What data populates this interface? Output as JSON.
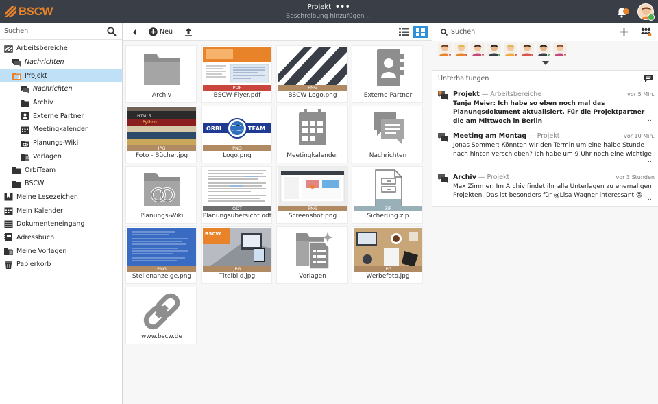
{
  "topbar": {
    "logo_text": "BSCW",
    "title": "Projekt",
    "title_menu": "•••",
    "subtitle": "Beschreibung hinzufügen ...",
    "notification_count": "1",
    "accent": "#e8832a"
  },
  "left": {
    "search_label": "Suchen",
    "tree": [
      {
        "label": "Arbeitsbereiche",
        "icon": "workspaces-icon",
        "indent": 0,
        "italic": false,
        "selected": false
      },
      {
        "label": "Nachrichten",
        "icon": "messages-icon",
        "indent": 1,
        "italic": true,
        "selected": false
      },
      {
        "label": "Projekt",
        "icon": "project-folder-icon",
        "indent": 1,
        "italic": false,
        "selected": true
      },
      {
        "label": "Nachrichten",
        "icon": "messages-icon",
        "indent": 2,
        "italic": true,
        "selected": false
      },
      {
        "label": "Archiv",
        "icon": "folder-icon",
        "indent": 2,
        "italic": false,
        "selected": false
      },
      {
        "label": "Externe Partner",
        "icon": "contacts-icon",
        "indent": 2,
        "italic": false,
        "selected": false
      },
      {
        "label": "Meetingkalender",
        "icon": "calendar-icon",
        "indent": 2,
        "italic": false,
        "selected": false
      },
      {
        "label": "Planungs-Wiki",
        "icon": "wiki-icon",
        "indent": 2,
        "italic": false,
        "selected": false
      },
      {
        "label": "Vorlagen",
        "icon": "templates-icon",
        "indent": 2,
        "italic": false,
        "selected": false
      },
      {
        "label": "OrbiTeam",
        "icon": "folder-icon",
        "indent": 1,
        "italic": false,
        "selected": false
      },
      {
        "label": "BSCW",
        "icon": "folder-icon",
        "indent": 1,
        "italic": false,
        "selected": false
      },
      {
        "label": "Meine Lesezeichen",
        "icon": "bookmarks-icon",
        "indent": 0,
        "italic": false,
        "selected": false
      },
      {
        "label": "Mein Kalender",
        "icon": "calendar-icon",
        "indent": 0,
        "italic": false,
        "selected": false
      },
      {
        "label": "Dokumenteneingang",
        "icon": "inbox-icon",
        "indent": 0,
        "italic": false,
        "selected": false
      },
      {
        "label": "Adressbuch",
        "icon": "addressbook-icon",
        "indent": 0,
        "italic": false,
        "selected": false
      },
      {
        "label": "Meine Vorlagen",
        "icon": "templates-icon",
        "indent": 0,
        "italic": false,
        "selected": false
      },
      {
        "label": "Papierkorb",
        "icon": "trash-icon",
        "indent": 0,
        "italic": false,
        "selected": false
      }
    ]
  },
  "toolbar": {
    "new_label": "Neu"
  },
  "tiles": [
    {
      "name": "Archiv",
      "kind": "folder",
      "badge": ""
    },
    {
      "name": "BSCW Flyer.pdf",
      "kind": "flyer",
      "badge": "PDF"
    },
    {
      "name": "BSCW Logo.png",
      "kind": "stripes",
      "badge": "PNG"
    },
    {
      "name": "Externe Partner",
      "kind": "contacts",
      "badge": ""
    },
    {
      "name": "Foto - Bücher.jpg",
      "kind": "books",
      "badge": "JPG"
    },
    {
      "name": "Logo.png",
      "kind": "orbiteam",
      "badge": "PNG"
    },
    {
      "name": "Meetingkalender",
      "kind": "calendar",
      "badge": ""
    },
    {
      "name": "Nachrichten",
      "kind": "chat",
      "badge": ""
    },
    {
      "name": "Planungs-Wiki",
      "kind": "wiki",
      "badge": ""
    },
    {
      "name": "Planungsübersicht.odt",
      "kind": "doc",
      "badge": "ODT"
    },
    {
      "name": "Screenshot.png",
      "kind": "screenshot",
      "badge": "PNG"
    },
    {
      "name": "Sicherung.zip",
      "kind": "zip",
      "badge": "ZIP"
    },
    {
      "name": "Stellenanzeige.png",
      "kind": "job",
      "badge": "PNG"
    },
    {
      "name": "Titelbild.jpg",
      "kind": "titel",
      "badge": "JPG"
    },
    {
      "name": "Vorlagen",
      "kind": "templates",
      "badge": ""
    },
    {
      "name": "Werbefoto.jpg",
      "kind": "desk",
      "badge": "JPG"
    },
    {
      "name": "www.bscw.de",
      "kind": "link",
      "badge": ""
    }
  ],
  "tile_thumb_logo_text": {
    "orbi": "ORBI",
    "team": "TEAM",
    "bscw": "BSCW"
  },
  "right": {
    "search_label": "Suchen",
    "section_title": "Unterhaltungen",
    "avatars": [
      {
        "name": "user-1",
        "skin": "#f0c29a",
        "hair": "#6b3b1f",
        "shirt": "#e8832a",
        "status": "#d9534f"
      },
      {
        "name": "user-2",
        "skin": "#f3c9a3",
        "hair": "#e0b64a",
        "shirt": "#e8832a",
        "status": "#d9534f"
      },
      {
        "name": "user-3",
        "skin": "#f0c29a",
        "hair": "#3a2a20",
        "shirt": "#c24a7a",
        "status": "#d9534f"
      },
      {
        "name": "user-4",
        "skin": "#e8b48c",
        "hair": "#222222",
        "shirt": "#3a3f47",
        "status": "#4caf50"
      },
      {
        "name": "user-5",
        "skin": "#f3c9a3",
        "hair": "#e0b64a",
        "shirt": "#f2a93b",
        "status": "#d9534f"
      },
      {
        "name": "user-6",
        "skin": "#f0c29a",
        "hair": "#4a2e1e",
        "shirt": "#d9534f",
        "status": "#d9534f"
      },
      {
        "name": "user-7",
        "skin": "#e8b48c",
        "hair": "#222222",
        "shirt": "#3a3f47",
        "status": "#4caf50"
      },
      {
        "name": "user-8",
        "skin": "#f3c9a3",
        "hair": "#8b4a2b",
        "shirt": "#c24a7a",
        "status": "#d9534f"
      }
    ],
    "conversations": [
      {
        "title": "Projekt",
        "location": "Arbeitsbereiche",
        "time": "vor 5 Min.",
        "body": "Tanja Meier: Ich habe so eben noch mal das Planungsdokument aktualisiert. Für die Projektpartner die am Mittwoch in Berlin",
        "unread": true
      },
      {
        "title": "Meeting am Montag",
        "location": "Projekt",
        "time": "vor 10 Min.",
        "body": "Jonas Sommer: Könnten wir den Termin um eine halbe Stunde nach hinten verschieben? Ich habe um 9 Uhr noch eine wichtige",
        "unread": false
      },
      {
        "title": "Archiv",
        "location": "Projekt",
        "time": "vor 3 Stunden",
        "body": "Max Zimmer: Im Archiv findet ihr alle Unterlagen zu ehemaligen Projekten. Das ist besonders für @Lisa Wagner interessant 😉",
        "unread": false
      }
    ]
  }
}
